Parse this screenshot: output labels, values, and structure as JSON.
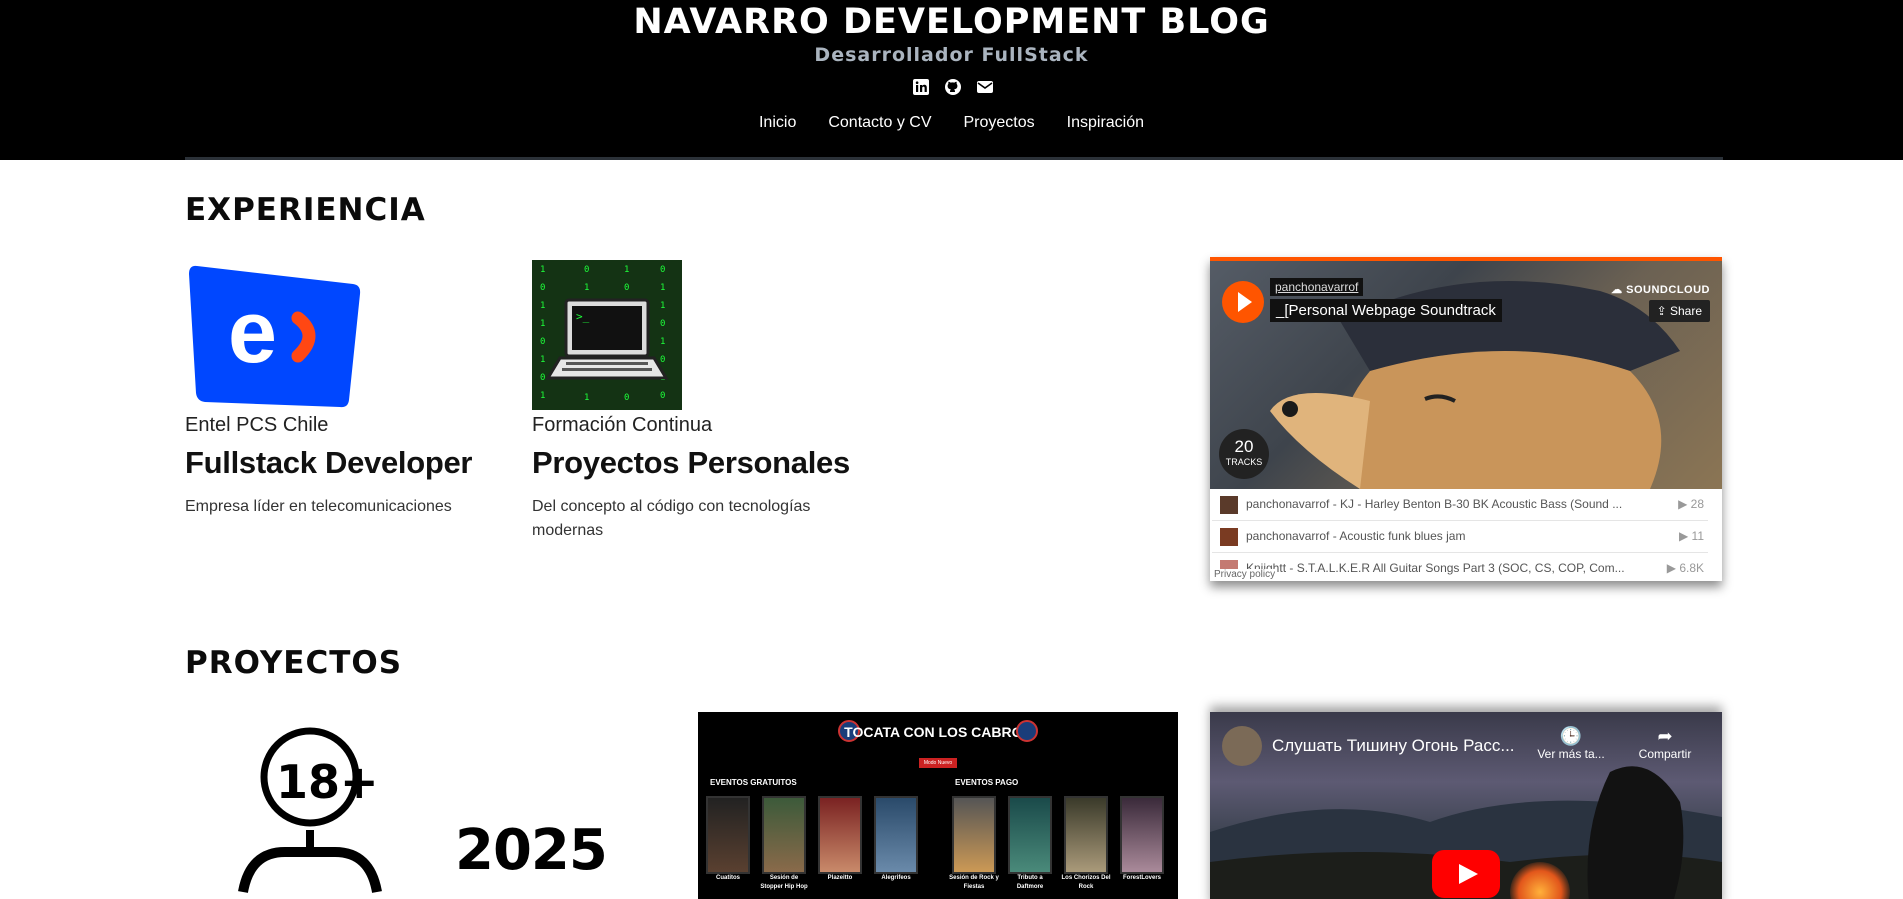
{
  "header": {
    "title": "NAVARRO DEVELOPMENT BLOG",
    "subtitle": "Desarrollador FullStack",
    "social": [
      "linkedin-icon",
      "github-icon",
      "email-icon"
    ],
    "nav": [
      "Inicio",
      "Contacto y CV",
      "Proyectos",
      "Inspiración"
    ]
  },
  "experience": {
    "title": "EXPERIENCIA",
    "cards": [
      {
        "company": "Entel PCS Chile",
        "role": "Fullstack Developer",
        "desc": "Empresa líder en telecomunicaciones"
      },
      {
        "company": "Formación Continua",
        "role": "Proyectos Personales",
        "desc": "Del concepto al código con tecnologías modernas"
      }
    ]
  },
  "soundcloud": {
    "user": "panchonavarrof",
    "playlist": "_[Personal Webpage Soundtrack",
    "brand": "SOUNDCLOUD",
    "share": "Share",
    "tracks_count": "20",
    "tracks_label": "TRACKS",
    "tracks": [
      {
        "name": "panchonavarrof - KJ - Harley Benton B-30 BK Acoustic Bass (Sound ...",
        "plays": "28"
      },
      {
        "name": "panchonavarrof - Acoustic funk blues jam",
        "plays": "11"
      },
      {
        "name": "Kniightt - S.T.A.L.K.E.R All Guitar Songs Part 3 (SOC, CS, COP, Com...",
        "plays": "6.8K"
      }
    ],
    "privacy": "Privacy policy",
    "accent": "#ff5500"
  },
  "projects": {
    "title": "PROYECTOS",
    "age_badge": "18+",
    "year": "2025",
    "tocata": {
      "title": "TOCATA CON LOS CABROS",
      "button": "Modo Nuevo",
      "free_label": "EVENTOS GRATUITOS",
      "paid_label": "EVENTOS PAGO",
      "captions": [
        "Cuatitos",
        "Sesión de Stopper Hip Hop",
        "Plazeitto",
        "Alegrifeos",
        "Sesión de Rock y Fiestas",
        "Tributo a Daftmore",
        "Los Chorizos Del Rock",
        "ForestLovers"
      ]
    },
    "youtube": {
      "title": "Слушать Тишину Огонь Расс...",
      "watch_later": "Ver más ta...",
      "share": "Compartir"
    }
  }
}
